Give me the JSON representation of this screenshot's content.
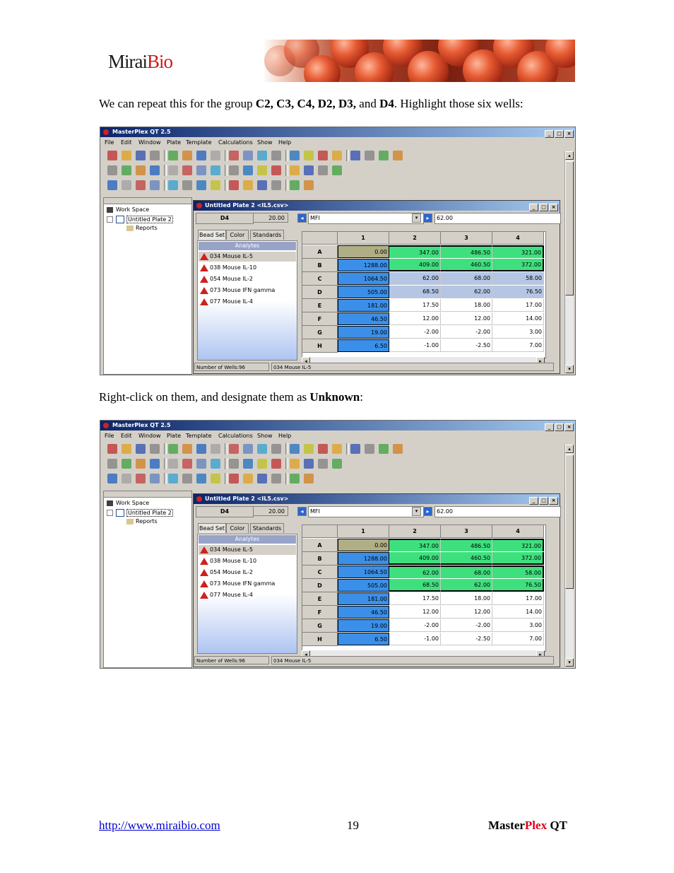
{
  "header": {
    "logo_main": "Mirai",
    "logo_accent": "Bio"
  },
  "paragraph1": {
    "text_a": "We can repeat this for the group ",
    "bold_a": "C2, C3, C4, D2, D3,",
    "text_b": " and ",
    "bold_b": "D4",
    "text_c": ".  Highlight those six wells:"
  },
  "paragraph2": {
    "text_a": "Right-click on them, and designate them as ",
    "bold": "Unknown",
    "text_b": ":"
  },
  "app": {
    "window_title": "MasterPlex QT 2.5",
    "menu": [
      "File",
      "Edit",
      "Window",
      "Plate",
      "Template",
      "Calculations",
      "Show",
      "Help"
    ],
    "tree": {
      "workspace": "Work Space",
      "plate": "Untitled Plate 2",
      "reports": "Reports"
    },
    "child_title": "Untitled Plate 2 <IL5.csv>",
    "well": "D4",
    "value": "20.00",
    "measure": "MFI",
    "measure_value": "62.00",
    "tabs": [
      "Bead Set",
      "Color",
      "Standards"
    ],
    "analytes_header": "Analytes",
    "analytes": [
      "034 Mouse IL-5",
      "038 Mouse IL-10",
      "054 Mouse IL-2",
      "073 Mouse IFN gamma",
      "077 Mouse IL-4"
    ],
    "columns": [
      "1",
      "2",
      "3",
      "4"
    ],
    "rows": [
      "A",
      "B",
      "C",
      "D",
      "E",
      "F",
      "G",
      "H"
    ],
    "grid": [
      [
        "0.00",
        "347.00",
        "486.50",
        "321.00"
      ],
      [
        "1288.00",
        "409.00",
        "460.50",
        "372.00"
      ],
      [
        "1064.50",
        "62.00",
        "68.00",
        "58.00"
      ],
      [
        "505.00",
        "68.50",
        "62.00",
        "76.50"
      ],
      [
        "181.00",
        "17.50",
        "18.00",
        "17.00"
      ],
      [
        "46.50",
        "12.00",
        "12.00",
        "14.00"
      ],
      [
        "19.00",
        "-2.00",
        "-2.00",
        "3.00"
      ],
      [
        "6.50",
        "-1.00",
        "-2.50",
        "7.00"
      ]
    ],
    "status_wells": "Number of Wells:96",
    "status_analyte": "034 Mouse IL-5"
  },
  "colors": {
    "standard_blue": "#3b8fe8",
    "control_olive": "#b0ae84",
    "sample_green": "#3ee07e",
    "selected_blue": "#b4c6e4"
  },
  "footer": {
    "link": "http://www.miraibio.com",
    "page": "19",
    "product_a": "Master",
    "product_b": "Plex",
    "product_c": " QT"
  }
}
